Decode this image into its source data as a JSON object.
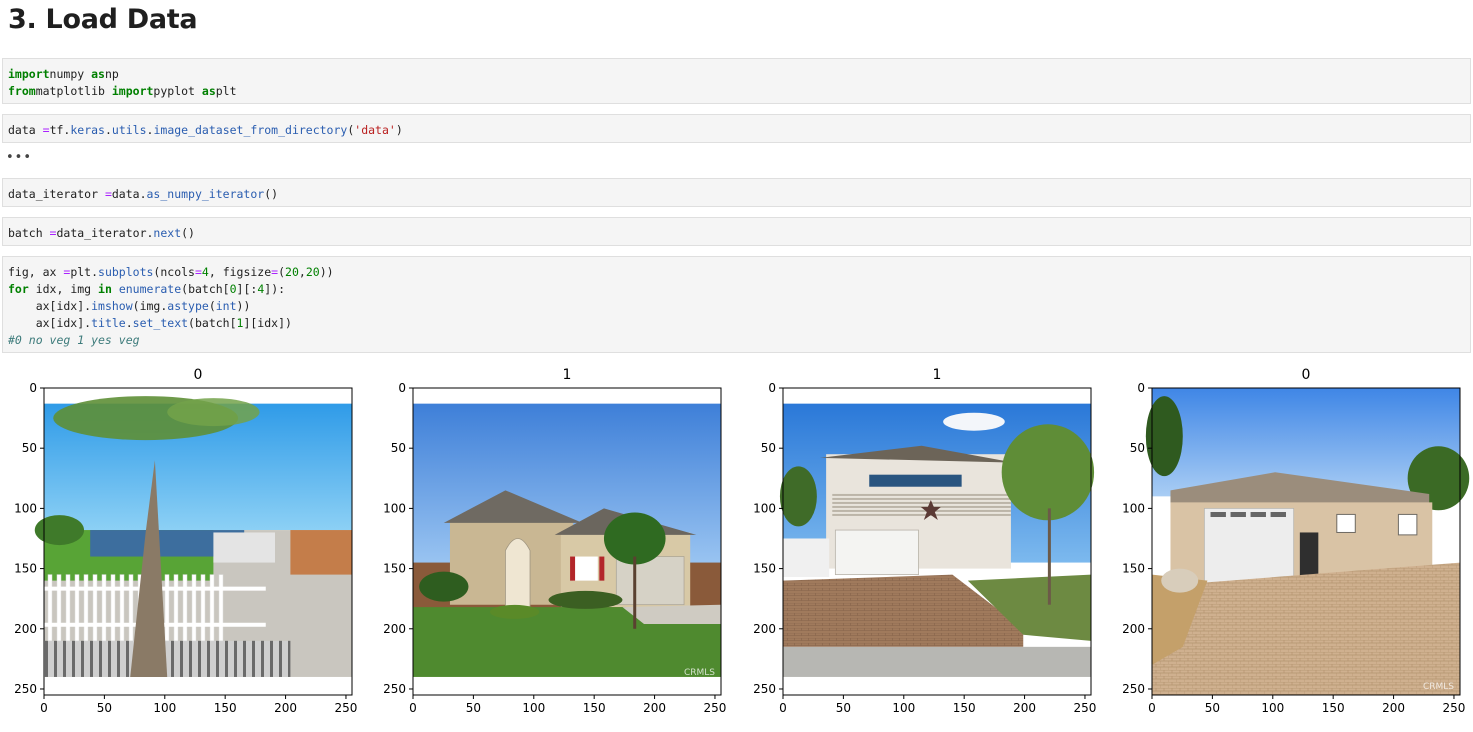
{
  "heading": "3. Load Data",
  "cells": [
    {
      "id": "imports",
      "lines": [
        [
          [
            "kw",
            "import"
          ],
          [
            "",
            "numpy "
          ],
          [
            "kw",
            "as"
          ],
          [
            "",
            "np"
          ]
        ],
        [
          [
            "kw",
            "from"
          ],
          [
            "",
            "matplotlib "
          ],
          [
            "kw",
            "import"
          ],
          [
            "",
            "pyplot "
          ],
          [
            "kw",
            "as"
          ],
          [
            "",
            "plt"
          ]
        ]
      ]
    },
    {
      "id": "load",
      "lines": [
        [
          [
            "",
            "data "
          ],
          [
            "op",
            "="
          ],
          [
            "",
            "tf."
          ],
          [
            "fn",
            "keras"
          ],
          [
            ".",
            ""
          ],
          [
            "fn",
            "utils"
          ],
          [
            ".",
            ""
          ],
          [
            "fn",
            "image_dataset_from_directory"
          ],
          [
            "",
            "("
          ],
          [
            "str",
            "'data'"
          ],
          [
            "",
            ")"
          ]
        ]
      ]
    },
    {
      "id": "iter",
      "lines": [
        [
          [
            "",
            "data_iterator "
          ],
          [
            "op",
            "="
          ],
          [
            "",
            "data."
          ],
          [
            "fn",
            "as_numpy_iterator"
          ],
          [
            "",
            "()"
          ]
        ]
      ]
    },
    {
      "id": "batch",
      "lines": [
        [
          [
            "",
            "batch "
          ],
          [
            "op",
            "="
          ],
          [
            "",
            "data_iterator."
          ],
          [
            "fn",
            "next"
          ],
          [
            "",
            "()"
          ]
        ]
      ]
    },
    {
      "id": "plot",
      "lines": [
        [
          [
            "",
            "fig, ax "
          ],
          [
            "op",
            "="
          ],
          [
            "",
            "plt."
          ],
          [
            "fn",
            "subplots"
          ],
          [
            "",
            "(ncols"
          ],
          [
            "op",
            "="
          ],
          [
            "num",
            "4"
          ],
          [
            "",
            ", figsize"
          ],
          [
            "op",
            "="
          ],
          [
            "",
            "("
          ],
          [
            "num",
            "20"
          ],
          [
            "",
            ","
          ],
          [
            "num",
            "20"
          ],
          [
            "",
            "))"
          ]
        ],
        [
          [
            "kw",
            "for"
          ],
          [
            "",
            "",
            " idx, img "
          ],
          [
            "kw",
            "in"
          ],
          [
            "",
            "",
            " "
          ],
          [
            "fn",
            "enumerate"
          ],
          [
            "",
            "(batch["
          ],
          [
            "num",
            "0"
          ],
          [
            "",
            "][:"
          ],
          [
            "num",
            "4"
          ],
          [
            "",
            "]):"
          ]
        ],
        [
          [
            "",
            "    ax[idx]."
          ],
          [
            "fn",
            "imshow"
          ],
          [
            "",
            "(img."
          ],
          [
            "fn",
            "astype"
          ],
          [
            "",
            "("
          ],
          [
            "fn",
            "int"
          ],
          [
            "",
            "))"
          ]
        ],
        [
          [
            "",
            "    ax[idx]."
          ],
          [
            "fn",
            "title"
          ],
          [
            "",
            "."
          ],
          [
            "fn",
            "set_text"
          ],
          [
            "",
            "(batch["
          ],
          [
            "num",
            "1"
          ],
          [
            "",
            "][idx])"
          ]
        ],
        [
          [
            "cm",
            "#0 no veg 1 yes veg"
          ]
        ]
      ]
    }
  ],
  "output_more": "•••",
  "figure": {
    "titles": [
      "0",
      "1",
      "1",
      "0"
    ],
    "y_ticks": [
      "0",
      "50",
      "100",
      "150",
      "200",
      "250"
    ],
    "x_ticks": [
      "0",
      "50",
      "100",
      "150",
      "200",
      "250"
    ],
    "y_tick_values": [
      0,
      50,
      100,
      150,
      200,
      250
    ],
    "x_tick_values": [
      0,
      50,
      100,
      150,
      200,
      250
    ],
    "axis_range": [
      0,
      255
    ],
    "watermarks": [
      "",
      "CRMLS",
      "",
      "CRMLS"
    ],
    "colors": {
      "sky_bright": "#3aa0e8",
      "sky_blue": "#4f8fe0",
      "grass": "#4f8a2f",
      "driveway": "#9c7d62",
      "stucco": "#d9c3a5"
    }
  }
}
